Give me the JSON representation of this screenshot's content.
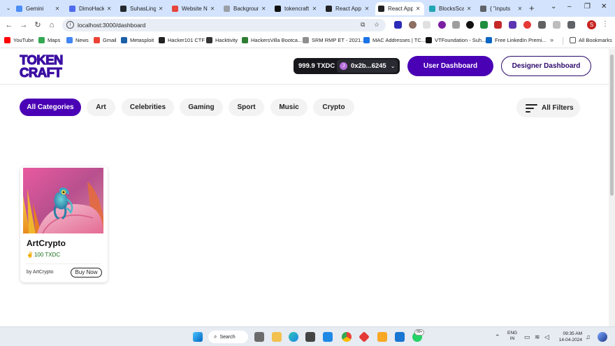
{
  "browser": {
    "tabs": [
      {
        "title": "Gemini",
        "favicon_color": "#4c8df6"
      },
      {
        "title": "DimoHack",
        "favicon_color": "#4f6bed"
      },
      {
        "title": "SuhasLing",
        "favicon_color": "#24292f"
      },
      {
        "title": "Website N",
        "favicon_color": "#e8453c"
      },
      {
        "title": "Backgroun",
        "favicon_color": "#9aa0a6"
      },
      {
        "title": "tokencraft",
        "favicon_color": "#111111"
      },
      {
        "title": "React App",
        "favicon_color": "#222222"
      },
      {
        "title": "React App",
        "favicon_color": "#222222",
        "active": true
      },
      {
        "title": "BlocksSca",
        "favicon_color": "#21a6b3"
      },
      {
        "title": "{ \"inputs",
        "favicon_color": "#5f6368"
      }
    ],
    "new_tab": "+",
    "window_controls": [
      "⌄",
      "–",
      "❐",
      "✕"
    ],
    "url": "localhost:3000/dashboard",
    "bookmarks": [
      {
        "label": "YouTube",
        "color": "#ff0000"
      },
      {
        "label": "Maps",
        "color": "#34a853"
      },
      {
        "label": "News",
        "color": "#4285f4"
      },
      {
        "label": "Gmail",
        "color": "#ea4335"
      },
      {
        "label": "Metasploit",
        "color": "#1b5fa7"
      },
      {
        "label": "Hacker101 CTF",
        "color": "#222222"
      },
      {
        "label": "Hacktivity",
        "color": "#333333"
      },
      {
        "label": "HackersVilla Bootca...",
        "color": "#2e7d32"
      },
      {
        "label": "SRM RMP ET - 2021...",
        "color": "#8e8e8e"
      },
      {
        "label": "MAC Addresses | TC...",
        "color": "#1a73e8"
      },
      {
        "label": "VTFoundation - Suh...",
        "color": "#111111"
      },
      {
        "label": "Free LinkedIn Premi...",
        "color": "#0a66c2"
      }
    ],
    "more_bookmarks": "»",
    "all_bookmarks": "All Bookmarks",
    "profile_initial": "S"
  },
  "site": {
    "logo": {
      "line1": "TOKEN",
      "line2": "CRAFT",
      "color": "#3c0fa3"
    },
    "wallet": {
      "balance": "999.9 TXDC",
      "address": "0x2b...6245"
    },
    "buttons": {
      "user_dashboard": "User Dashboard",
      "designer_dashboard": "Designer Dashboard"
    },
    "categories": [
      "All Categories",
      "Art",
      "Celebrities",
      "Gaming",
      "Sport",
      "Music",
      "Crypto"
    ],
    "active_category": "All Categories",
    "filters_label": "All Filters",
    "accent": "#4a00b4",
    "nft_card": {
      "title": "ArtCrypto",
      "price": "100 TXDC",
      "creator": "by ArtCrypto",
      "buy_label": "Buy Now",
      "image_alt": "chameleon on pink petal"
    }
  },
  "taskbar": {
    "search_label": "Search",
    "badge": "99+",
    "language": {
      "line1": "ENG",
      "line2": "IN"
    },
    "time": "09:35 AM",
    "date": "14-04-2024"
  }
}
